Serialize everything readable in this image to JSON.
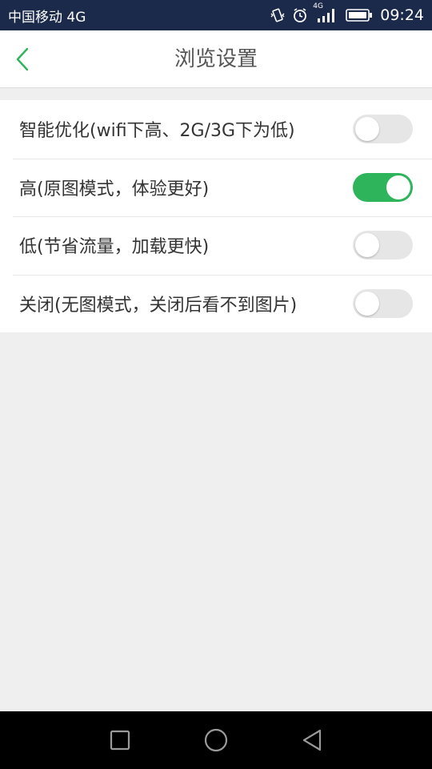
{
  "status_bar": {
    "carrier": "中国移动 4G",
    "network_badge": "4G",
    "time": "09:24",
    "icons": [
      "vibrate-icon",
      "alarm-icon",
      "signal-icon",
      "battery-icon"
    ]
  },
  "header": {
    "title": "浏览设置",
    "back_icon": "chevron-left-icon"
  },
  "settings": [
    {
      "label": "智能优化(wifi下高、2G/3G下为低)",
      "enabled": false
    },
    {
      "label": "高(原图模式，体验更好)",
      "enabled": true
    },
    {
      "label": "低(节省流量，加载更快)",
      "enabled": false
    },
    {
      "label": "关闭(无图模式，关闭后看不到图片)",
      "enabled": false
    }
  ],
  "nav_bar": {
    "buttons": [
      "recent-apps-icon",
      "home-icon",
      "back-icon"
    ]
  },
  "colors": {
    "accent": "#2eb45a",
    "status_bar": "#1b2a4a",
    "toggle_off": "#e6e6e6"
  }
}
